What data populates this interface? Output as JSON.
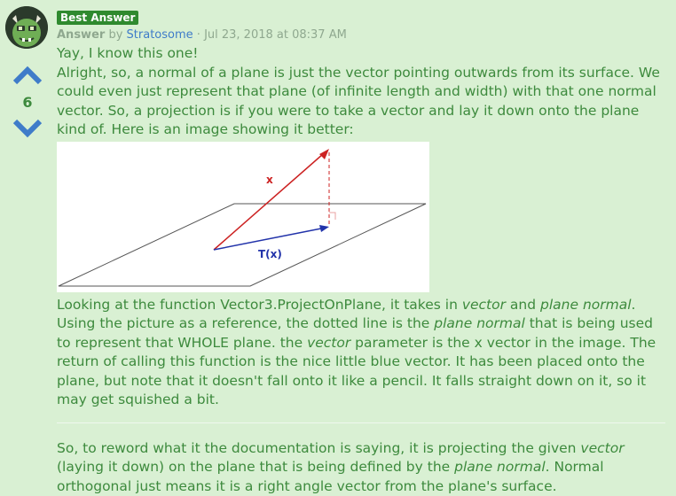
{
  "post": {
    "badge": "Best Answer",
    "answer_word": "Answer",
    "by": "by",
    "author": "Stratosome",
    "separator": "·",
    "timestamp": "Jul 23, 2018 at 08:37 AM"
  },
  "vote": {
    "count": "6",
    "up_icon": "chevron-up-icon",
    "down_icon": "chevron-down-icon"
  },
  "body": {
    "p1": "Yay, I know this one!",
    "p2": "Alright, so, a normal of a plane is just the vector pointing outwards from its surface. We could even just represent that plane (of infinite length and width) with that one normal vector. So, a projection is if you were to take a vector and lay it down onto the plane kind of. Here is an image showing it better:",
    "figure": {
      "label_x": "x",
      "label_tx": "T(x)"
    },
    "p3": [
      "Looking at the function Vector3.ProjectOnPlane, it takes in ",
      "vector",
      " and ",
      "plane normal",
      ". Using the picture as a reference, the dotted line is the ",
      "plane normal",
      " that is being used to represent that WHOLE plane. the ",
      "vector",
      " parameter is the x vector in the image. The return of calling this function is the nice little blue vector. It has been placed onto the plane, but note that it doesn't fall onto it like a pencil. It falls straight down on it, so it may get squished a bit."
    ],
    "p4": [
      "So, to reword what it the documentation is saying, it is projecting the given ",
      "vector",
      " (laying it down) on the plane that is being defined by the ",
      "plane normal",
      ". Normal orthogonal just means it is a right angle vector from the plane's surface."
    ]
  },
  "colors": {
    "background": "#d9f0d3",
    "text": "#3d8a3d",
    "link": "#3f7cc9",
    "badge": "#2f8a2f",
    "vote_arrow": "#3f7cc9",
    "vector_x": "#cc2222",
    "vector_tx": "#2233aa"
  }
}
